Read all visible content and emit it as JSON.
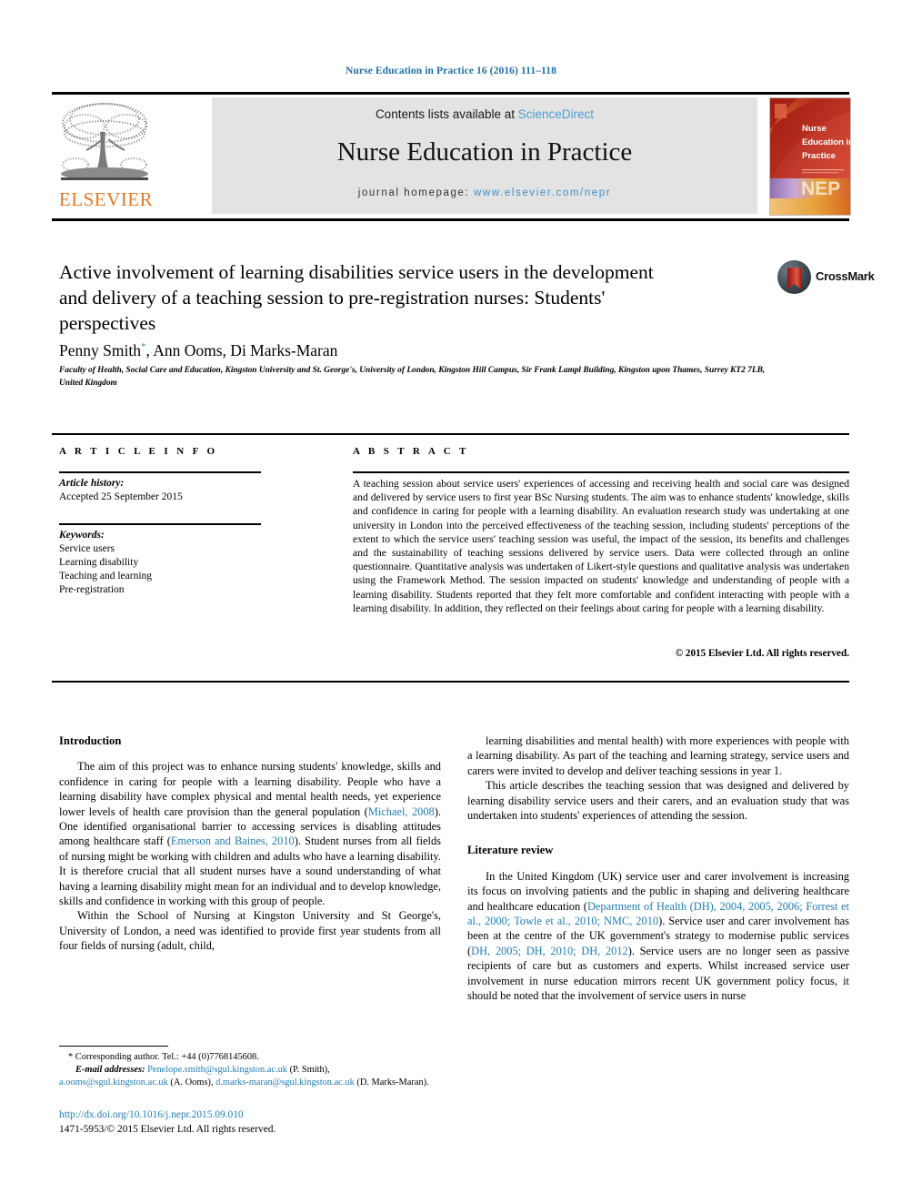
{
  "running_head": "Nurse Education in Practice 16 (2016) 111–118",
  "masthead": {
    "contents_prefix": "Contents lists available at ",
    "contents_link": "ScienceDirect",
    "journal_title": "Nurse Education in Practice",
    "homepage_prefix": "journal homepage: ",
    "homepage_link": "www.elsevier.com/nepr",
    "publisher": "ELSEVIER",
    "cover": {
      "line1": "Nurse",
      "line2": "Education in",
      "line3": "Practice",
      "acronym": "NEP"
    },
    "colors": {
      "link_blue": "#4a9fd4",
      "elsevier_orange": "#e87722",
      "band_grey": "#e3e3e3"
    }
  },
  "article": {
    "title": "Active involvement of learning disabilities service users in the development and delivery of a teaching session to pre-registration nurses: Students' perspectives",
    "crossmark_label": "CrossMark",
    "authors": "Penny Smith",
    "authors_marker": "*",
    "authors_rest": ", Ann Ooms, Di Marks-Maran",
    "affiliation": "Faculty of Health, Social Care and Education, Kingston University and St. George's, University of London, Kingston Hill Campus, Sir Frank Lampl Building, Kingston upon Thames, Surrey KT2 7LB, United Kingdom"
  },
  "article_info": {
    "heading": "A R T I C L E   I N F O",
    "history_label": "Article history:",
    "history_value": "Accepted 25 September 2015",
    "keywords_label": "Keywords:",
    "keywords": [
      "Service users",
      "Learning disability",
      "Teaching and learning",
      "Pre-registration"
    ]
  },
  "abstract": {
    "heading": "A B S T R A C T",
    "body": "A teaching session about service users' experiences of accessing and receiving health and social care was designed and delivered by service users to first year BSc Nursing students. The aim was to enhance students' knowledge, skills and confidence in caring for people with a learning disability. An evaluation research study was undertaking at one university in London into the perceived effectiveness of the teaching session, including students' perceptions of the extent to which the service users' teaching session was useful, the impact of the session, its benefits and challenges and the sustainability of teaching sessions delivered by service users. Data were collected through an online questionnaire. Quantitative analysis was undertaken of Likert-style questions and qualitative analysis was undertaken using the Framework Method. The session impacted on students' knowledge and understanding of people with a learning disability. Students reported that they felt more comfortable and confident interacting with people with a learning disability. In addition, they reflected on their feelings about caring for people with a learning disability.",
    "copyright": "© 2015 Elsevier Ltd. All rights reserved."
  },
  "body": {
    "left": {
      "heading": "Introduction",
      "para1_a": "The aim of this project was to enhance nursing students' knowledge, skills and confidence in caring for people with a learning disability. People who have a learning disability have complex physical and mental health needs, yet experience lower levels of health care provision than the general population (",
      "para1_cite1": "Michael, 2008",
      "para1_b": "). One identified organisational barrier to accessing services is disabling attitudes among healthcare staff (",
      "para1_cite2": "Emerson and Baines, 2010",
      "para1_c": "). Student nurses from all fields of nursing might be working with children and adults who have a learning disability. It is therefore crucial that all student nurses have a sound understanding of what having a learning disability might mean for an individual and to develop knowledge, skills and confidence in working with this group of people.",
      "para2": "Within the School of Nursing at Kingston University and St George's, University of London, a need was identified to provide first year students from all four fields of nursing (adult, child,"
    },
    "right": {
      "para1": "learning disabilities and mental health) with more experiences with people with a learning disability. As part of the teaching and learning strategy, service users and carers were invited to develop and deliver teaching sessions in year 1.",
      "para2": "This article describes the teaching session that was designed and delivered by learning disability service users and their carers, and an evaluation study that was undertaken into students' experiences of attending the session.",
      "heading": "Literature review",
      "para3_a": "In the United Kingdom (UK) service user and carer involvement is increasing its focus on involving patients and the public in shaping and delivering healthcare and healthcare education (",
      "para3_cite1": "Department of Health (DH), 2004, 2005, 2006; Forrest et al., 2000; Towle et al., 2010; NMC, 2010",
      "para3_b": "). Service user and carer involvement has been at the centre of the UK government's strategy to modernise public services (",
      "para3_cite2": "DH, 2005; DH, 2010; DH, 2012",
      "para3_c": "). Service users are no longer seen as passive recipients of care but as customers and experts. Whilst increased service user involvement in nurse education mirrors recent UK government policy focus, it should be noted that the involvement of service users in nurse"
    }
  },
  "footnotes": {
    "corresponding": "* Corresponding author. Tel.: +44 (0)7768145608.",
    "email_label": "E-mail addresses:",
    "email1": "Penelope.smith@sgul.kingston.ac.uk",
    "email1_name": " (P. Smith), ",
    "email2": "a.ooms@sgul.kingston.ac.uk",
    "email2_name": " (A. Ooms), ",
    "email3": "d.marks-maran@sgul.kingston.ac.uk",
    "email3_name": " (D. Marks-Maran)."
  },
  "doi_block": {
    "doi": "http://dx.doi.org/10.1016/j.nepr.2015.09.010",
    "issn_copyright": "1471-5953/© 2015 Elsevier Ltd. All rights reserved."
  }
}
